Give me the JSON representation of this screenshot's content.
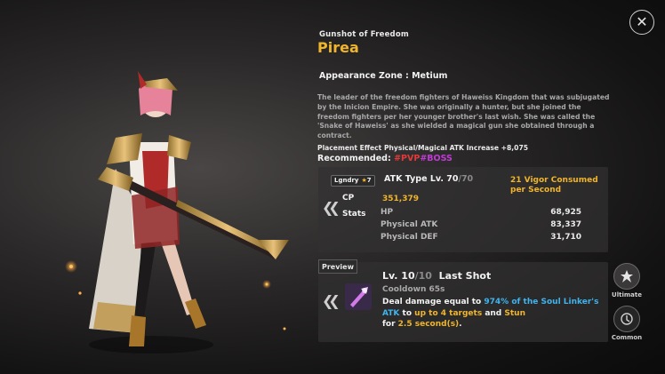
{
  "header": {
    "close_label": "✕",
    "subtitle": "Gunshot of Freedom",
    "name": "Pirea",
    "appearance_zone": "Appearance Zone : Metium"
  },
  "description": "The leader of the freedom fighters of Haweiss Kingdom that was subjugated by the Inicion Empire. She was originally a hunter, but she joined the freedom fighters per her younger brother's last wish. She was called the 'Snake of Haweiss' as she wielded a magical gun she obtained through a contract.",
  "placement_effect": "Placement Effect Physical/Magical ATK Increase +8,075",
  "recommended": {
    "label": "Recommended:",
    "tag_pvp": "#PVP",
    "tag_boss": "#BOSS"
  },
  "stats_panel": {
    "grade": "Lgndry",
    "stars": "7",
    "atk_type": "ATK Type Lv. 70",
    "lv_max": "/70",
    "vigor": "21 Vigor Consumed per Second",
    "cp_label": "CP",
    "cp_value": "351,379",
    "stats_label": "Stats",
    "stats": [
      {
        "name": "HP",
        "value": "68,925"
      },
      {
        "name": "Physical ATK",
        "value": "83,337"
      },
      {
        "name": "Physical DEF",
        "value": "31,710"
      }
    ]
  },
  "skill": {
    "preview_label": "Preview",
    "level": "Lv. 10",
    "level_max": "/10",
    "name": "Last Shot",
    "cooldown": "Cooldown 65s",
    "desc_1": "Deal damage equal to ",
    "desc_hl1": "974% of the Soul Linker's ATK",
    "desc_2": " to ",
    "desc_hl2": "up to 4 targets",
    "desc_3": " and ",
    "desc_hl3": "Stun",
    "desc_4": "for ",
    "desc_hl4": "2.5 second(s)",
    "desc_5": ".",
    "tabs": [
      {
        "label": "Ultimate",
        "icon": "ultimate-icon"
      },
      {
        "label": "Common",
        "icon": "common-icon"
      }
    ]
  },
  "colors": {
    "gold": "#f0b52b",
    "cyan": "#3fb4ee",
    "pvp_red": "#e23a3a",
    "boss_purple": "#c23ad6"
  }
}
